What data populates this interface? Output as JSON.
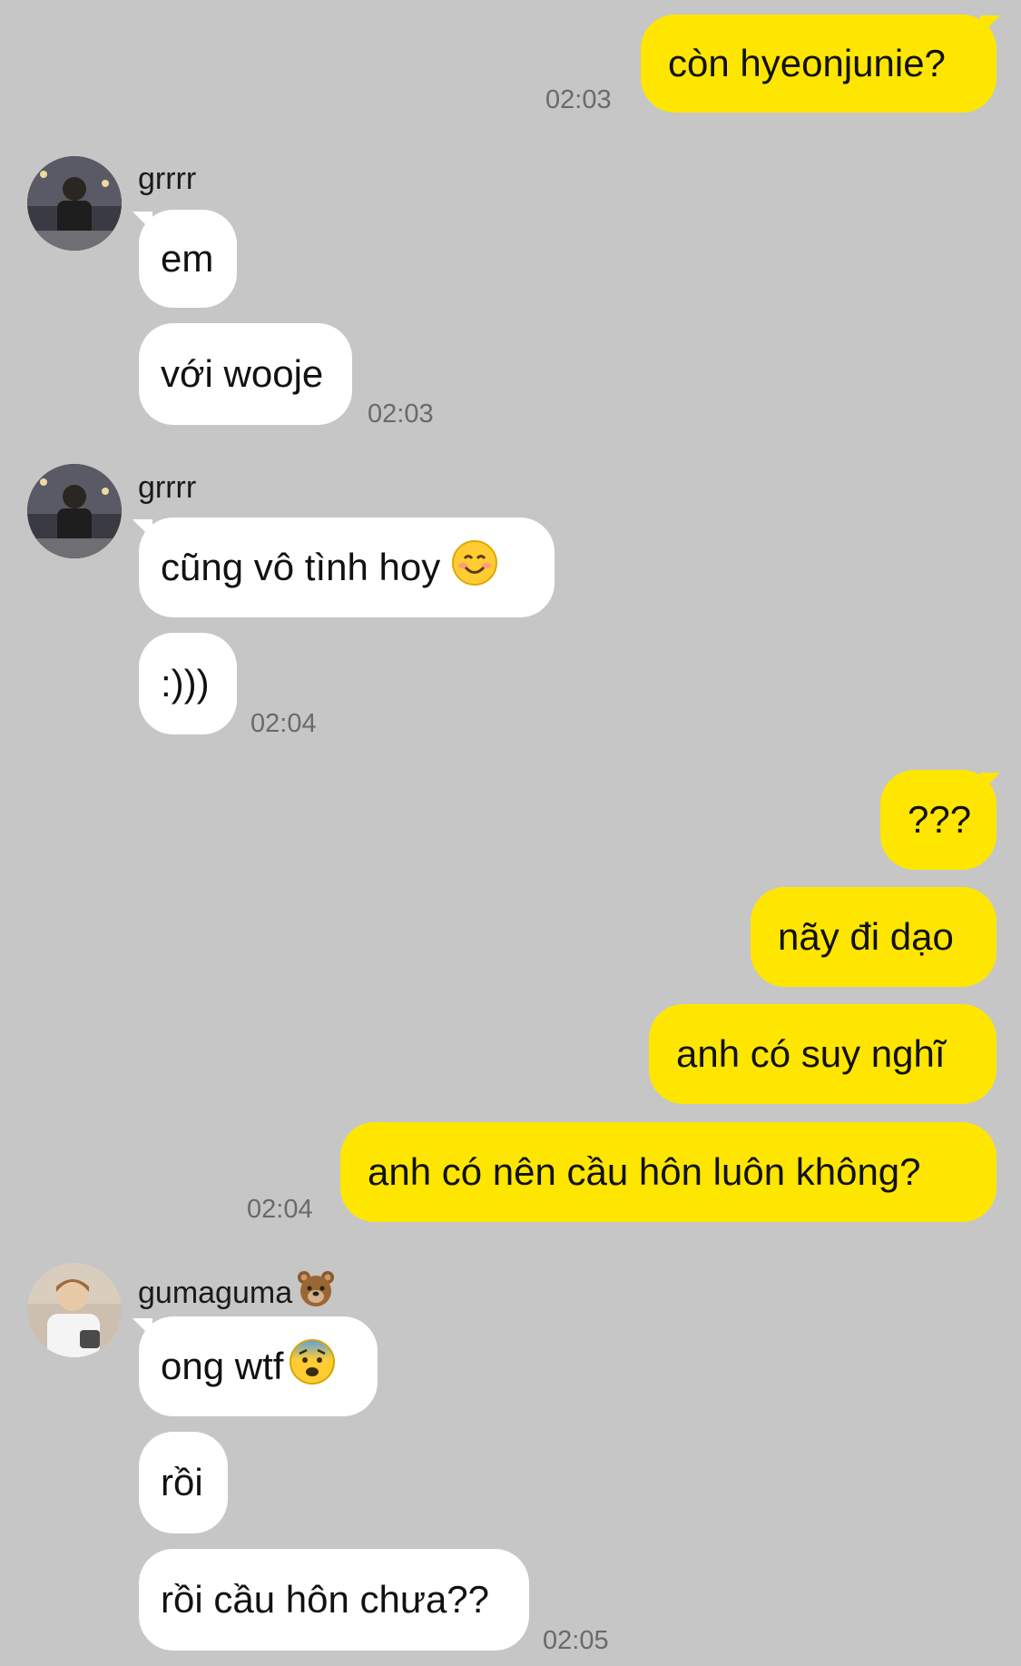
{
  "messages": [
    {
      "text": "còn hyeonjunie?",
      "time": "02:03"
    },
    {
      "sender": "grrrr",
      "texts": [
        "em",
        "với wooje"
      ],
      "time": "02:03"
    },
    {
      "sender": "grrrr",
      "texts": [
        "cũng vô tình hoy",
        ":)))"
      ],
      "time": "02:04"
    },
    {
      "texts": [
        "???",
        "nãy đi dạo",
        "anh có suy nghĩ",
        "anh có nên cầu hôn luôn không?"
      ],
      "time": "02:04"
    },
    {
      "sender": "gumaguma",
      "texts": [
        "ong wtf",
        "rồi",
        "rồi cầu hôn chưa??"
      ],
      "time": "02:05"
    }
  ],
  "icons": {
    "smile": "smiling-face-emoji",
    "bear": "bear-face-emoji",
    "fear": "fearful-face-emoji"
  },
  "colors": {
    "background": "#c6c6c6",
    "outgoing": "#ffe600",
    "incoming": "#ffffff"
  }
}
